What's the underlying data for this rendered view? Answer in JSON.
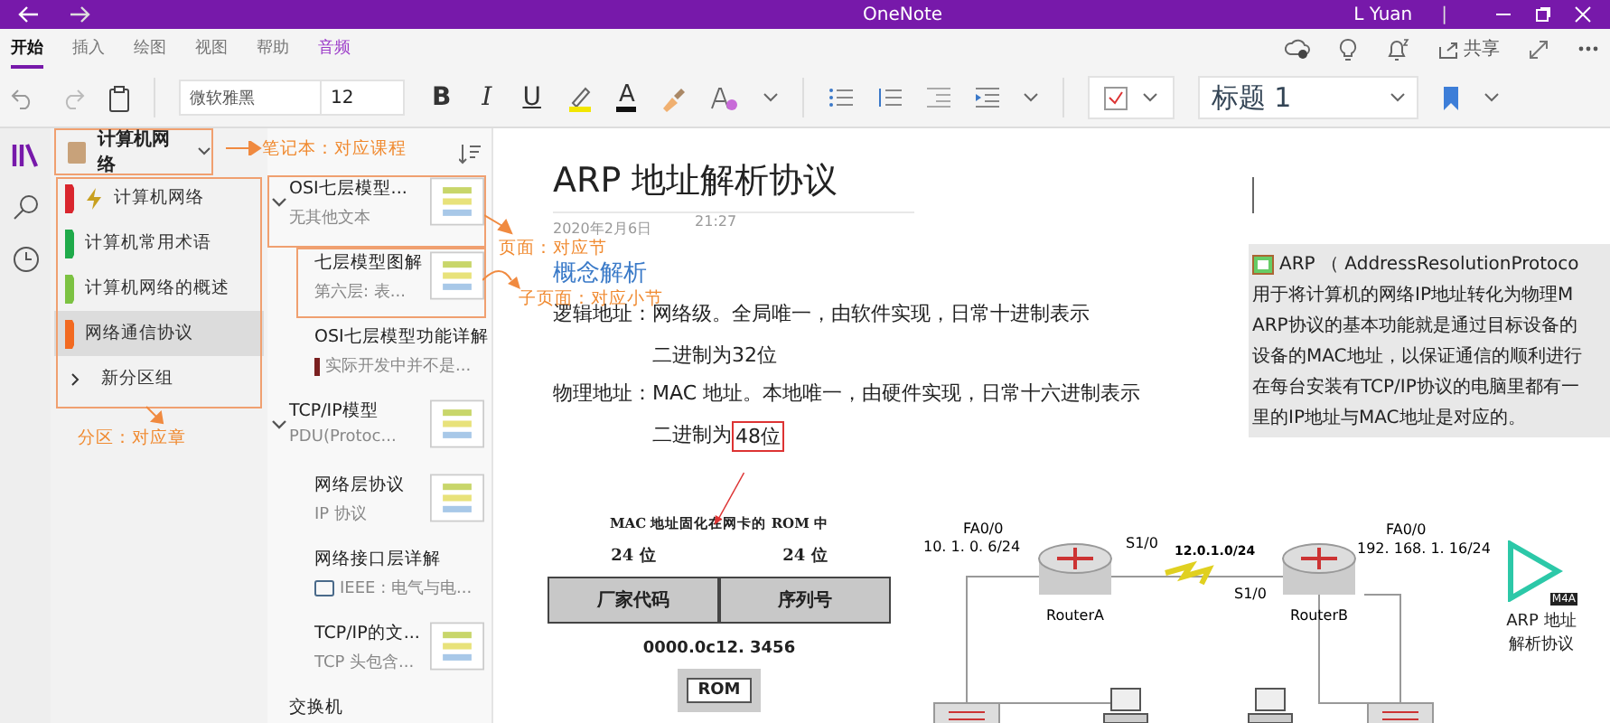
{
  "window": {
    "title": "OneNote",
    "user": "L Yuan",
    "separator": "|"
  },
  "ribbon_tabs": [
    {
      "label": "开始",
      "selected": true
    },
    {
      "label": "插入",
      "selected": false
    },
    {
      "label": "绘图",
      "selected": false
    },
    {
      "label": "视图",
      "selected": false
    },
    {
      "label": "帮助",
      "selected": false
    },
    {
      "label": "音频",
      "selected": false,
      "kind": "contextual"
    }
  ],
  "share": {
    "label": "共享"
  },
  "toolbar": {
    "font": "微软雅黑",
    "size": "12",
    "format_buttons": [
      {
        "label": "B",
        "kind": "bold"
      },
      {
        "label": "I",
        "kind": "italic"
      },
      {
        "label": "U",
        "kind": "underline"
      }
    ],
    "font_color": "A",
    "style": "标题 1"
  },
  "notebook": {
    "name": "计算机网络"
  },
  "sections": [
    {
      "label": "计算机网络",
      "color": "#d9262e",
      "selected": false,
      "kind": "bolt"
    },
    {
      "label": "计算机常用术语",
      "color": "#1faa4a",
      "selected": false,
      "kind": "plain"
    },
    {
      "label": "计算机网络的概述",
      "color": "#7cc242",
      "selected": false,
      "kind": "plain"
    },
    {
      "label": "网络通信协议",
      "color": "#f26a21",
      "selected": true,
      "kind": "plain"
    }
  ],
  "section_group": {
    "label": "新分区组",
    "expanded": false
  },
  "pages": [
    {
      "title": "OSI七层模型...",
      "preview": "无其他文本",
      "kind": "thumbnail",
      "expanded": true,
      "children": [
        {
          "title": "七层模型图解",
          "preview": "第六层: 表...",
          "kind": "thumbnail"
        },
        {
          "title": "OSI七层模型功能详解",
          "preview": "实际开发中并不是...",
          "kind": "flagged"
        }
      ]
    },
    {
      "title": "TCP/IP模型",
      "preview": "PDU(Protoc...",
      "kind": "thumbnail",
      "expanded": true,
      "children": [
        {
          "title": "网络层协议",
          "preview": "IP 协议",
          "kind": "thumbnail"
        },
        {
          "title": "网络接口层详解",
          "preview": "IEEE : 电气与电...",
          "kind": "boxed"
        },
        {
          "title": "TCP/IP的文...",
          "preview": "TCP 头包含...",
          "kind": "thumbnail"
        }
      ]
    },
    {
      "title": "交换机",
      "kind": "plain"
    }
  ],
  "annotations": [
    {
      "text": "笔记本：对应课程"
    },
    {
      "text": "分区：对应章"
    },
    {
      "text": "页面：对应节"
    },
    {
      "text": "子页面：对应小节"
    }
  ],
  "page": {
    "title": "ARP 地址解析协议",
    "date": "2020年2月6日",
    "time": "21:27",
    "heading": "概念解析",
    "rows": [
      {
        "label": "逻辑地址：",
        "lines": [
          [
            {
              "text": "网络级。全局唯一，由软件实现，日常十进制表示",
              "boxed": false
            }
          ],
          [
            {
              "text": "二进制为32位",
              "boxed": false
            }
          ]
        ]
      },
      {
        "label": "物理地址：",
        "lines": [
          [
            {
              "text": "MAC 地址。本地唯一，由硬件实现，日常十六进制表示",
              "boxed": false
            }
          ],
          [
            {
              "text": "二进制为",
              "boxed": false
            },
            {
              "text": "48位",
              "boxed": true
            }
          ]
        ]
      }
    ],
    "note": {
      "lines": [
        "ARP （ AddressResolutionProtoco",
        "用于将计算机的网络IP地址转化为物理M",
        "ARP协议的基本功能就是通过目标设备的",
        "设备的MAC地址，以保证通信的顺利进行",
        "在每台安装有TCP/IP协议的电脑里都有一",
        "里的IP地址与MAC地址是对应的。"
      ]
    },
    "mac_figure": {
      "caption": "MAC 地址固化在网卡的 ROM 中",
      "bits": [
        "24 位",
        "24 位"
      ],
      "fields": [
        "厂家代码",
        "序列号"
      ],
      "example": "0000.0c12. 3456",
      "chip": "ROM"
    },
    "network": {
      "left_port": "FA0/0",
      "left_ip": "10. 1. 0. 6/24",
      "left_serial": "S1/0",
      "link": "12.0.1.0/24",
      "right_serial": "S1/0",
      "right_port": "FA0/0",
      "right_ip": "192. 168. 1. 16/24",
      "router_a": "RouterA",
      "router_b": "RouterB"
    },
    "attachment": {
      "badge": "M4A",
      "lines": [
        "ARP 地址",
        "解析协议"
      ]
    }
  }
}
